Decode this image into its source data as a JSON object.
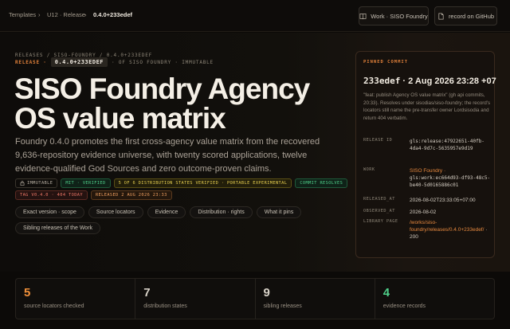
{
  "topbar": {
    "crumbs": [
      "Templates",
      "U12 · Release",
      "0.4.0+233edef"
    ],
    "sep": "›",
    "work_button": "Work · SISO Foundry",
    "github_button": "record on GitHub"
  },
  "hero": {
    "breadcrumb_path": "RELEASES / SISO-FOUNDRY / 0.4.0+233EDEF",
    "release_label": "RELEASE ·",
    "version_chip": "0.4.0+233EDEF",
    "release_suffix": "· OF SISO FOUNDRY · IMMUTABLE",
    "title": "SISO Foundry Agency OS value matrix",
    "description": "Foundry 0.4.0 promotes the first cross-agency value matrix from the recovered 9,636-repository evidence universe, with twenty scored applications, twelve evidence-qualified God Sources and zero outcome-proven claims.",
    "badges_row1": [
      {
        "label": "IMMUTABLE",
        "icon": "lock-icon",
        "tone": "neutral"
      },
      {
        "label": "MIT · VERIFIED",
        "tone": "green"
      },
      {
        "label": "5 OF 6 DISTRIBUTION STATES VERIFIED · PORTABLE EXPERIMENTAL",
        "tone": "yellow"
      },
      {
        "label": "COMMIT RESOLVES",
        "tone": "green"
      }
    ],
    "badges_row2": [
      {
        "label": "TAG V0.4.0 · 404 TODAY",
        "tone": "red"
      },
      {
        "label": "RELEASED 2 AUG 2026 23:33",
        "tone": "orange"
      }
    ],
    "tabs_row1": [
      "Exact version · scope",
      "Source locators",
      "Evidence",
      "Distribution · rights",
      "What it pins"
    ],
    "tabs_row2": [
      "Sibling releases of the Work"
    ]
  },
  "commit_card": {
    "label": "PINNED COMMIT",
    "hash": "233edef",
    "sep": " · ",
    "date": "2 Aug 2026 23:28 +07",
    "message": "\"feat: publish Agency OS value matrix\" (gh api commits, 20:33). Resolves under sisodias/siso-foundry; the record's locators still name the pre-transfer owner Lordsisodia and return 404 verbatim.",
    "rows": [
      {
        "key": "RELEASE ID",
        "value": "gls:release:47922651-40fb-4da4-9d7c-5635957e9d19",
        "style": "code"
      },
      {
        "key": "WORK",
        "value": "SISO Foundry · gls:work:ec664d93-df93-48c5-be40-5d0165886c01",
        "style": "work"
      },
      {
        "key": "RELEASED_AT",
        "value": "2026-08-02T23:33:05+07:00",
        "style": "plain"
      },
      {
        "key": "OBSERVED_AT",
        "value": "2026-08-02",
        "style": "plain"
      },
      {
        "key": "LIBRARY PAGE",
        "value": "/works/siso-foundry/releases/0.4.0+233edef/ · 200",
        "style": "link"
      }
    ],
    "work_name": "SISO Foundry ·",
    "work_id": "gls:work:ec664d93-df93-48c5-be40-5d0165886c01",
    "library_link": "/works/siso-foundry/releases/0.4.0+233edef/",
    "library_status": " · 200"
  },
  "stats": [
    {
      "value": "5",
      "label": "source locators checked",
      "color": "#f0903a"
    },
    {
      "value": "7",
      "label": "distribution states",
      "color": "#d8d2c8"
    },
    {
      "value": "9",
      "label": "sibling releases",
      "color": "#d8d2c8"
    },
    {
      "value": "4",
      "label": "evidence records",
      "color": "#4fd08a"
    }
  ]
}
